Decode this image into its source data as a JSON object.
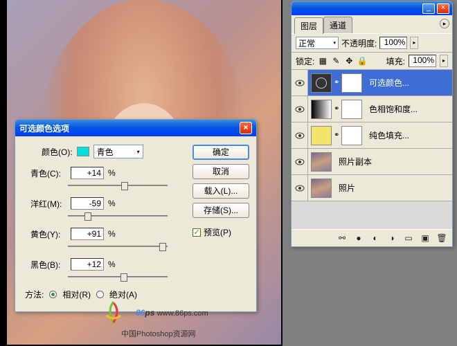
{
  "dialog": {
    "title": "可选颜色选项",
    "color_label": "颜色(O):",
    "color_name": "青色",
    "sliders": {
      "cyan_label": "青色(C):",
      "cyan_value": "+14",
      "magenta_label": "洋红(M):",
      "magenta_value": "-59",
      "yellow_label": "黄色(Y):",
      "yellow_value": "+91",
      "black_label": "黑色(B):",
      "black_value": "+12",
      "pct": "%"
    },
    "method_label": "方法:",
    "method_relative": "相对(R)",
    "method_absolute": "绝对(A)",
    "buttons": {
      "ok": "确定",
      "cancel": "取消",
      "load": "载入(L)...",
      "save": "存储(S)..."
    },
    "preview_label": "预览(P)"
  },
  "layers_panel": {
    "tabs": {
      "layers": "图层",
      "channels": "通道"
    },
    "blend_mode": "正常",
    "opacity_label": "不透明度:",
    "opacity_value": "100%",
    "lock_label": "锁定:",
    "fill_label": "填充:",
    "fill_value": "100%",
    "layers": [
      {
        "name": "可选颜色..."
      },
      {
        "name": "色相饱和度..."
      },
      {
        "name": "纯色填充..."
      },
      {
        "name": "照片副本"
      },
      {
        "name": "照片"
      }
    ]
  },
  "watermark": {
    "brand": "86",
    "brand_suffix": "ps",
    "url": "www.86ps.com",
    "subtitle": "中国Photoshop资源网"
  }
}
